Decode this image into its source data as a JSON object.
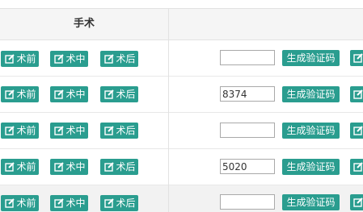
{
  "header": {
    "surgery_title": "手术"
  },
  "rows": [
    {
      "pre_label": "术前",
      "mid_label": "术中",
      "post_label": "术后",
      "code_value": "",
      "gen_label": "生成验证码"
    },
    {
      "pre_label": "术前",
      "mid_label": "术中",
      "post_label": "术后",
      "code_value": "8374",
      "gen_label": "生成验证码"
    },
    {
      "pre_label": "术前",
      "mid_label": "术中",
      "post_label": "术后",
      "code_value": "",
      "gen_label": "生成验证码"
    },
    {
      "pre_label": "术前",
      "mid_label": "术中",
      "post_label": "术后",
      "code_value": "5020",
      "gen_label": "生成验证码"
    },
    {
      "pre_label": "术前",
      "mid_label": "术中",
      "post_label": "术后",
      "code_value": "",
      "gen_label": "生成验证码"
    }
  ],
  "icons": {
    "op_icon": "edit-icon"
  },
  "colors": {
    "button_teal": "#2a9d8f",
    "header_bg": "#f5f5f5",
    "alt_row_bg": "#f2f2f2"
  }
}
